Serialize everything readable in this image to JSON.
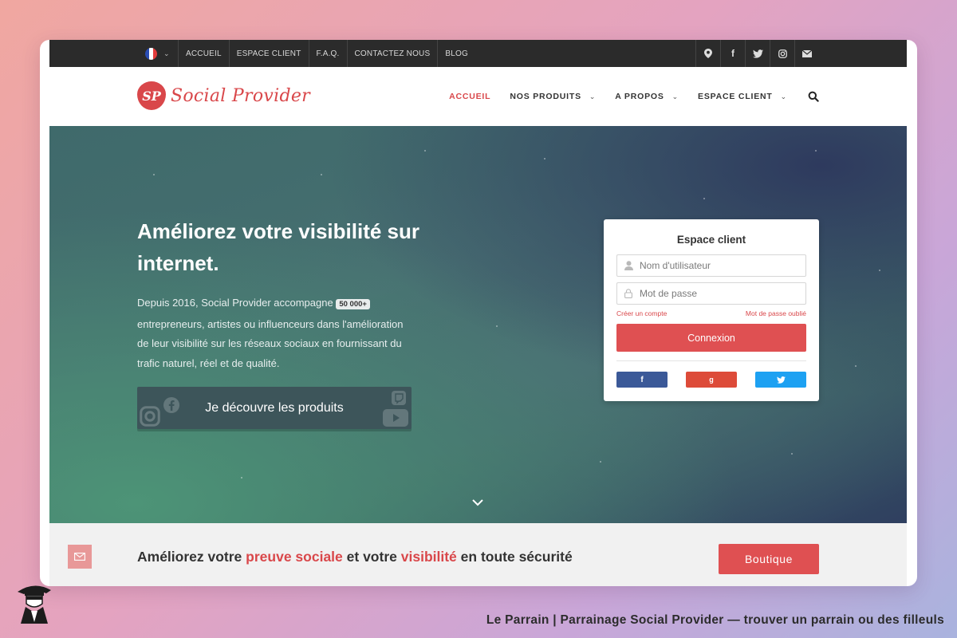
{
  "topbar": {
    "language_flag": "france-flag",
    "links": [
      "ACCUEIL",
      "ESPACE CLIENT",
      "F.A.Q.",
      "CONTACTEZ NOUS",
      "BLOG"
    ],
    "icons": [
      "location-icon",
      "facebook-icon",
      "twitter-icon",
      "instagram-icon",
      "mail-icon"
    ]
  },
  "brand": {
    "logo_initials": "SP",
    "name": "Social Provider",
    "color": "#d9474a"
  },
  "nav": {
    "items": [
      {
        "label": "ACCUEIL",
        "active": true
      },
      {
        "label": "NOS PRODUITS",
        "active": false
      },
      {
        "label": "A PROPOS",
        "active": false
      },
      {
        "label": "ESPACE CLIENT",
        "active": false
      }
    ]
  },
  "hero": {
    "title": "Améliorez votre visibilité sur internet.",
    "text_before": "Depuis 2016, Social Provider accompagne",
    "badge": "50 000+",
    "text_after": "entrepreneurs, artistes ou influenceurs dans l'amélioration de leur visibilité sur les réseaux sociaux en fournissant du trafic naturel, réel et de qualité.",
    "cta_label": "Je découvre les produits"
  },
  "login": {
    "title": "Espace client",
    "username_placeholder": "Nom d'utilisateur",
    "password_placeholder": "Mot de passe",
    "create_account": "Créer un compte",
    "forgot_password": "Mot de passe oublié",
    "submit_label": "Connexion",
    "social": [
      {
        "name": "facebook",
        "glyph": "f",
        "color": "#3b5998"
      },
      {
        "name": "google",
        "glyph": "g",
        "color": "#dd4b39"
      },
      {
        "name": "twitter",
        "glyph": "t",
        "color": "#1da1f2"
      }
    ]
  },
  "strip": {
    "part1": "Améliorez votre",
    "hl1": "preuve sociale",
    "part2": "et votre",
    "hl2": "visibilité",
    "part3": "en toute sécurité",
    "button_label": "Boutique"
  },
  "credit": {
    "text": "Le Parrain | Parrainage Social Provider — trouver un parrain ou des filleuls"
  }
}
